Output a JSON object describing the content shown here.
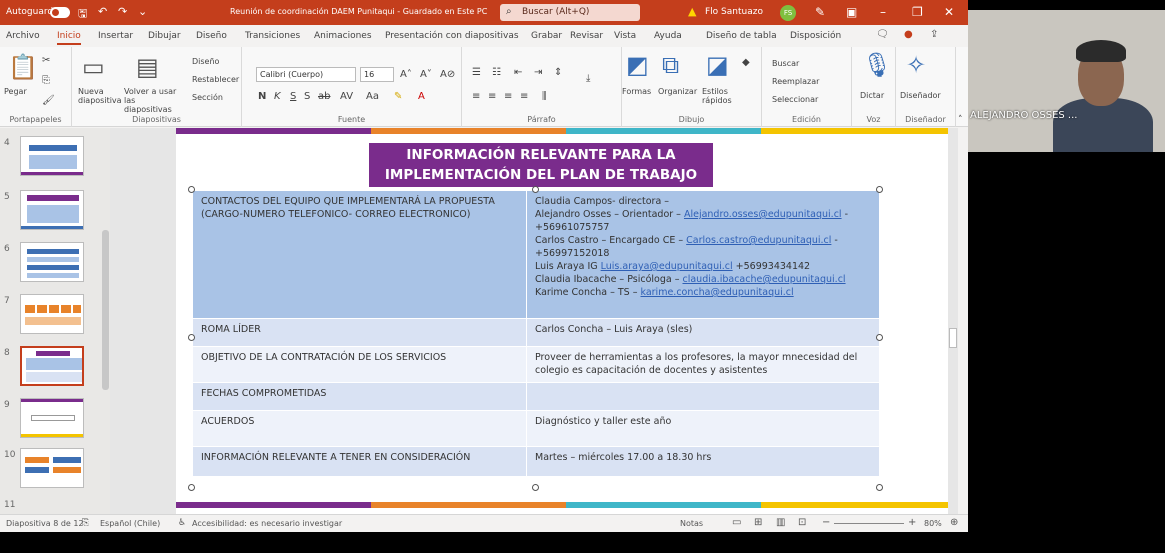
{
  "titlebar": {
    "autosave": "Autoguardado",
    "doc_title": "Reunión de coordinación DAEM Punitaqui - Guardado en Este PC",
    "search_placeholder": "Buscar (Alt+Q)",
    "user": "Flo Santuazo",
    "avatar_initials": "FS"
  },
  "menu": [
    "Archivo",
    "Inicio",
    "Insertar",
    "Dibujar",
    "Diseño",
    "Transiciones",
    "Animaciones",
    "Presentación con diapositivas",
    "Grabar",
    "Revisar",
    "Vista",
    "Ayuda",
    "Diseño de tabla",
    "Disposición"
  ],
  "ribbon": {
    "paste": "Pegar",
    "new_slide": "Nueva diapositiva",
    "reuse": "Volver a usar las diapositivas",
    "layout": "Diseño",
    "reset": "Restablecer",
    "section": "Sección",
    "font_name": "Calibri (Cuerpo)",
    "font_size": "16",
    "shapes": "Formas",
    "arrange": "Organizar",
    "quick_styles": "Estilos rápidos",
    "find": "Buscar",
    "replace": "Reemplazar",
    "select": "Seleccionar",
    "dictate": "Dictar",
    "designer": "Diseñador",
    "groups": [
      "Portapapeles",
      "Diapositivas",
      "Fuente",
      "Párrafo",
      "Dibujo",
      "Edición",
      "Voz",
      "Diseñador"
    ]
  },
  "slides_panel": {
    "numbers": [
      "4",
      "5",
      "6",
      "7",
      "8",
      "9",
      "10",
      "11"
    ]
  },
  "slide": {
    "title": "INFORMACIÓN RELEVANTE PARA LA IMPLEMENTACIÓN DEL PLAN DE TRABAJO",
    "rows": [
      {
        "label": "CONTACTOS DEL EQUIPO QUE IMPLEMENTARÁ LA PROPUESTA (CARGO-NUMERO TELEFONICO- CORREO ELECTRONICO)",
        "lines": [
          {
            "text": "Claudia Campos- directora –",
            "link": ""
          },
          {
            "text": "Alejandro Osses – Orientador – ",
            "link": "Alejandro.osses@edupunitaqui.cl",
            "after": " -"
          },
          {
            "text": "+56961075757",
            "link": ""
          },
          {
            "text": "Carlos Castro – Encargado CE – ",
            "link": "Carlos.castro@edupunitaqui.cl",
            "after": " -"
          },
          {
            "text": "+56997152018",
            "link": ""
          },
          {
            "text": "Luis Araya   IG  ",
            "link": "Luis.araya@edupunitaqui.cl",
            "after": "  +56993434142"
          },
          {
            "text": "Claudia Ibacache – Psicóloga – ",
            "link": "claudia.ibacache@edupunitaqui.cl",
            "after": ""
          },
          {
            "text": "Karime Concha – TS – ",
            "link": "karime.concha@edupunitaqui.cl",
            "after": ""
          }
        ]
      },
      {
        "label": "ROMA LÍDER",
        "value": "Carlos Concha – Luis Araya (sles)"
      },
      {
        "label": "OBJETIVO DE LA CONTRATACIÓN DE LOS SERVICIOS",
        "value": "Proveer de herramientas a los profesores, la mayor mnecesidad del colegio es capacitación de docentes y asistentes"
      },
      {
        "label": "FECHAS COMPROMETIDAS",
        "value": ""
      },
      {
        "label": "ACUERDOS",
        "value": "Diagnóstico y taller este año"
      },
      {
        "label": "INFORMACIÓN RELEVANTE A TENER EN CONSIDERACIÓN",
        "value": "Martes – miércoles 17.00 a 18.30 hrs"
      }
    ]
  },
  "status": {
    "slide_counter": "Diapositiva 8 de 12",
    "language": "Español (Chile)",
    "accessibility": "Accesibilidad: es necesario investigar",
    "notes": "Notas",
    "zoom": "80%"
  },
  "video": {
    "participant_name": "ALEJANDRO OSSES ..."
  },
  "colors": {
    "accent": "#c43e1c",
    "title_bg": "#7a2c8c",
    "row_dark": "#a9c3e6",
    "row_light": "#d9e2f3"
  }
}
